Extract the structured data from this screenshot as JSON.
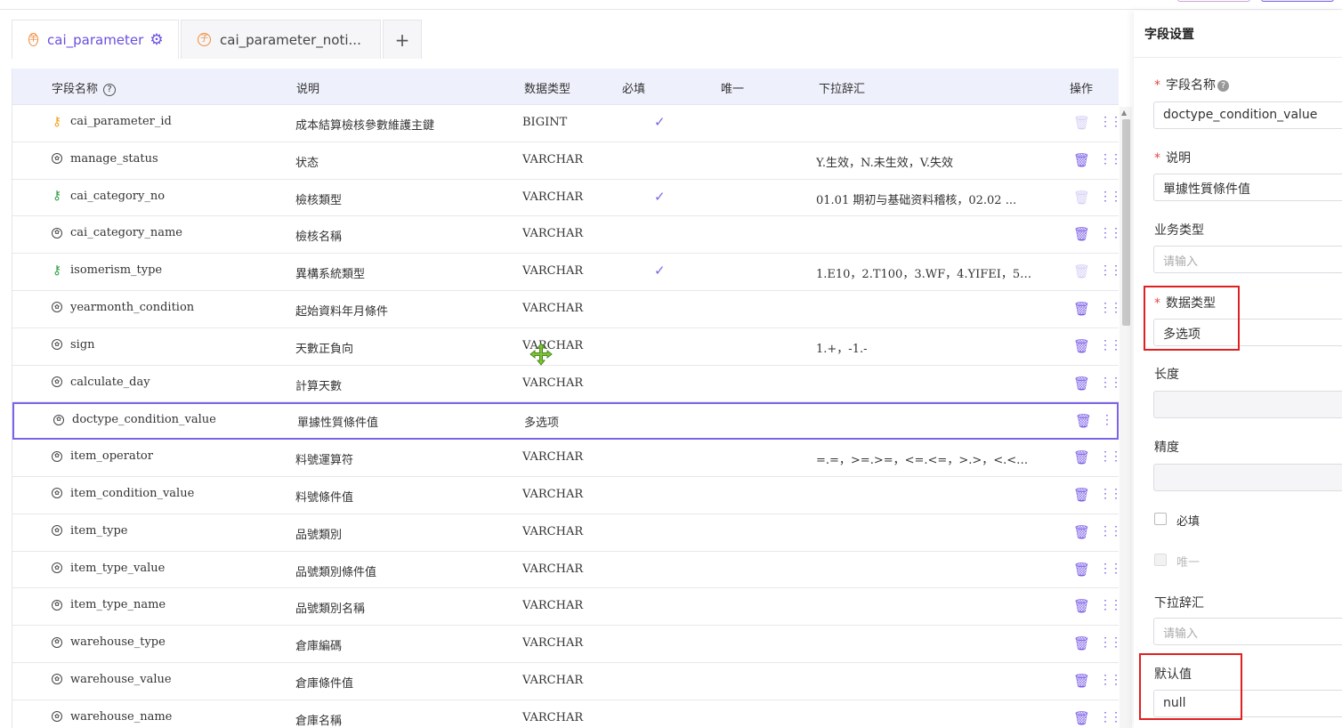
{
  "tabs": [
    {
      "label": "cai_parameter",
      "icon": "table-icon",
      "active": true
    },
    {
      "label": "cai_parameter_noti...",
      "icon": "table-icon",
      "active": false
    }
  ],
  "add_tab_label": "+",
  "table": {
    "headers": {
      "name": "字段名称",
      "desc": "说明",
      "type": "数据类型",
      "required": "必填",
      "unique": "唯一",
      "dropdown": "下拉辞汇",
      "actions": "操作"
    },
    "rows": [
      {
        "name": "cai_parameter_id",
        "key": "primary",
        "desc": "成本結算檢核參數維護主鍵",
        "type": "BIGINT",
        "required": true,
        "dropdown": "",
        "deletable": false
      },
      {
        "name": "manage_status",
        "key": "",
        "desc": "状态",
        "type": "VARCHAR",
        "required": false,
        "dropdown": "Y.生效，N.未生效，V.失效",
        "deletable": true
      },
      {
        "name": "cai_category_no",
        "key": "foreign",
        "desc": "檢核類型",
        "type": "VARCHAR",
        "required": true,
        "dropdown": "01.01 期初与基础资料稽核，02.02 ...",
        "deletable": false
      },
      {
        "name": "cai_category_name",
        "key": "",
        "desc": "檢核名稱",
        "type": "VARCHAR",
        "required": false,
        "dropdown": "",
        "deletable": true
      },
      {
        "name": "isomerism_type",
        "key": "foreign",
        "desc": "異構系統類型",
        "type": "VARCHAR",
        "required": true,
        "dropdown": "1.E10，2.T100，3.WF，4.YIFEI，5....",
        "deletable": false
      },
      {
        "name": "yearmonth_condition",
        "key": "",
        "desc": "起始資料年月條件",
        "type": "VARCHAR",
        "required": false,
        "dropdown": "",
        "deletable": true
      },
      {
        "name": "sign",
        "key": "",
        "desc": "天數正負向",
        "type": "VARCHAR",
        "required": false,
        "dropdown": "1.+，-1.-",
        "deletable": true
      },
      {
        "name": "calculate_day",
        "key": "",
        "desc": "計算天數",
        "type": "VARCHAR",
        "required": false,
        "dropdown": "",
        "deletable": true
      },
      {
        "name": "doctype_condition_value",
        "key": "",
        "desc": "單據性質條件值",
        "type": "多选项",
        "required": false,
        "dropdown": "",
        "deletable": true,
        "selected": true
      },
      {
        "name": "item_operator",
        "key": "",
        "desc": "料號運算符",
        "type": "VARCHAR",
        "required": false,
        "dropdown": "=.=，>=.>=，<=.<=，>.>，<.<，<>....",
        "deletable": true
      },
      {
        "name": "item_condition_value",
        "key": "",
        "desc": "料號條件值",
        "type": "VARCHAR",
        "required": false,
        "dropdown": "",
        "deletable": true
      },
      {
        "name": "item_type",
        "key": "",
        "desc": "品號類別",
        "type": "VARCHAR",
        "required": false,
        "dropdown": "",
        "deletable": true
      },
      {
        "name": "item_type_value",
        "key": "",
        "desc": "品號類別條件值",
        "type": "VARCHAR",
        "required": false,
        "dropdown": "",
        "deletable": true
      },
      {
        "name": "item_type_name",
        "key": "",
        "desc": "品號類別名稱",
        "type": "VARCHAR",
        "required": false,
        "dropdown": "",
        "deletable": true
      },
      {
        "name": "warehouse_type",
        "key": "",
        "desc": "倉庫編碼",
        "type": "VARCHAR",
        "required": false,
        "dropdown": "",
        "deletable": true
      },
      {
        "name": "warehouse_value",
        "key": "",
        "desc": "倉庫條件值",
        "type": "VARCHAR",
        "required": false,
        "dropdown": "",
        "deletable": true
      },
      {
        "name": "warehouse_name",
        "key": "",
        "desc": "倉庫名稱",
        "type": "VARCHAR",
        "required": false,
        "dropdown": "",
        "deletable": true
      }
    ]
  },
  "panel": {
    "title": "字段设置",
    "field_name_label": "字段名称",
    "field_name_value": "doctype_condition_value",
    "desc_label": "说明",
    "desc_value": "單據性質條件值",
    "biz_type_label": "业务类型",
    "biz_type_placeholder": "请输入",
    "data_type_label": "数据类型",
    "data_type_value": "多选项",
    "length_label": "长度",
    "length_value": "",
    "precision_label": "精度",
    "precision_value": "",
    "required_label": "必填",
    "unique_label": "唯一",
    "dropdown_label": "下拉辞汇",
    "dropdown_placeholder": "请输入",
    "default_label": "默认值",
    "default_value": "null"
  },
  "colors": {
    "accent": "#6a4fe0",
    "highlight_box": "#e02020",
    "required_star": "#e54848"
  }
}
